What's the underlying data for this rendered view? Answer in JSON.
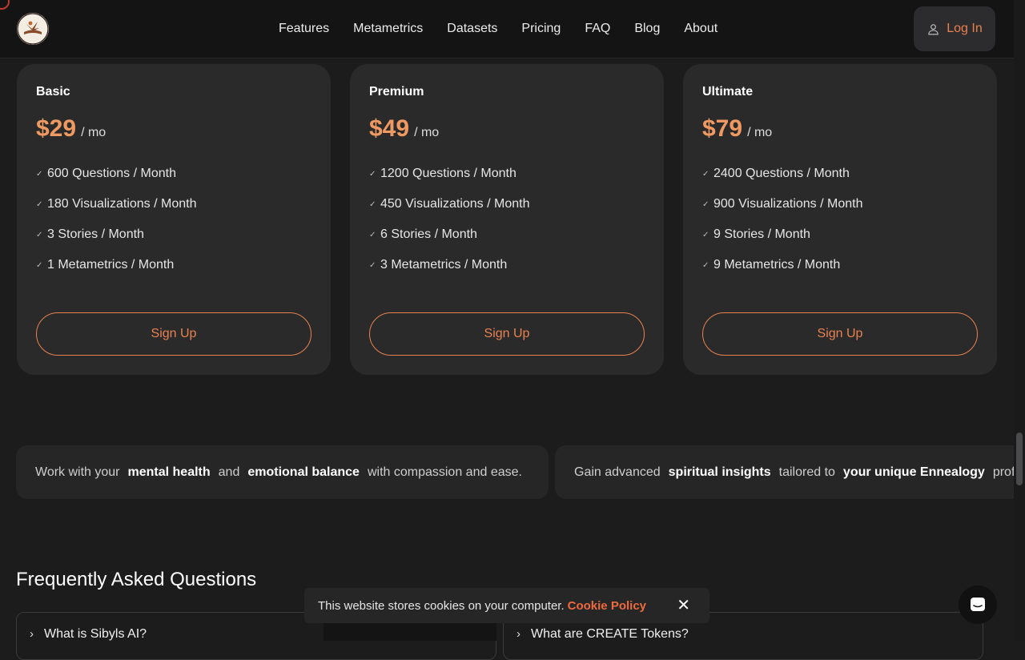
{
  "header": {
    "nav": [
      "Features",
      "Metametrics",
      "Datasets",
      "Pricing",
      "FAQ",
      "Blog",
      "About"
    ],
    "login_label": "Log In"
  },
  "plans": [
    {
      "name": "Basic",
      "price": "$29",
      "per": "/ mo",
      "features": [
        "600 Questions / Month",
        "180 Visualizations / Month",
        "3 Stories / Month",
        "1 Metametrics / Month"
      ],
      "cta": "Sign Up"
    },
    {
      "name": "Premium",
      "price": "$49",
      "per": "/ mo",
      "features": [
        "1200 Questions / Month",
        "450 Visualizations / Month",
        "6 Stories / Month",
        "3 Metametrics / Month"
      ],
      "cta": "Sign Up"
    },
    {
      "name": "Ultimate",
      "price": "$79",
      "per": "/ mo",
      "features": [
        "2400 Questions / Month",
        "900 Visualizations / Month",
        "9 Stories / Month",
        "9 Metametrics / Month"
      ],
      "cta": "Sign Up"
    }
  ],
  "marquee": [
    {
      "t1": "Work with your",
      "h1": "mental health",
      "t2": "and",
      "h2": "emotional balance",
      "t3": "with compassion and ease."
    },
    {
      "t1": "Gain advanced",
      "h1": "spiritual insights",
      "t2": "tailored to",
      "h2": "your unique Ennealogy",
      "t3": "profi"
    }
  ],
  "faq": {
    "title": "Frequently Asked Questions",
    "items": [
      "What is Sibyls AI?",
      "What are CREATE Tokens?"
    ]
  },
  "cookie": {
    "text": "This website stores cookies on your computer.",
    "link": "Cookie Policy",
    "close": "✕"
  },
  "colors": {
    "accent": "#e8814f",
    "price": "#ee9a62",
    "background": "#1c1c1d",
    "card": "#2a2a2b"
  }
}
